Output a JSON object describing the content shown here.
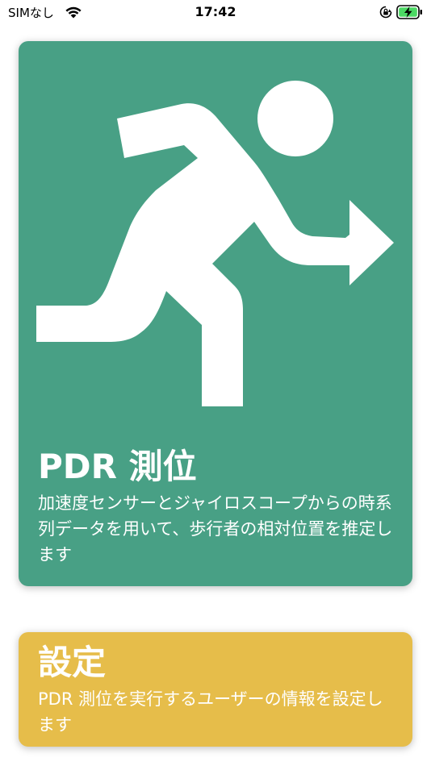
{
  "status_bar": {
    "carrier": "SIMなし",
    "time": "17:42",
    "wifi_icon": "wifi-icon",
    "lock_icon": "orientation-lock-icon",
    "battery_icon": "battery-charging-icon"
  },
  "cards": {
    "pdr": {
      "title": "PDR 測位",
      "description": "加速度センサーとジャイロスコープからの時系列データを用いて、歩行者の相対位置を推定します",
      "icon": "running-person-icon",
      "color": "#48a085"
    },
    "settings": {
      "title": "設定",
      "description": "PDR 測位を実行するユーザーの情報を設定します",
      "color": "#e6bd4a"
    }
  }
}
